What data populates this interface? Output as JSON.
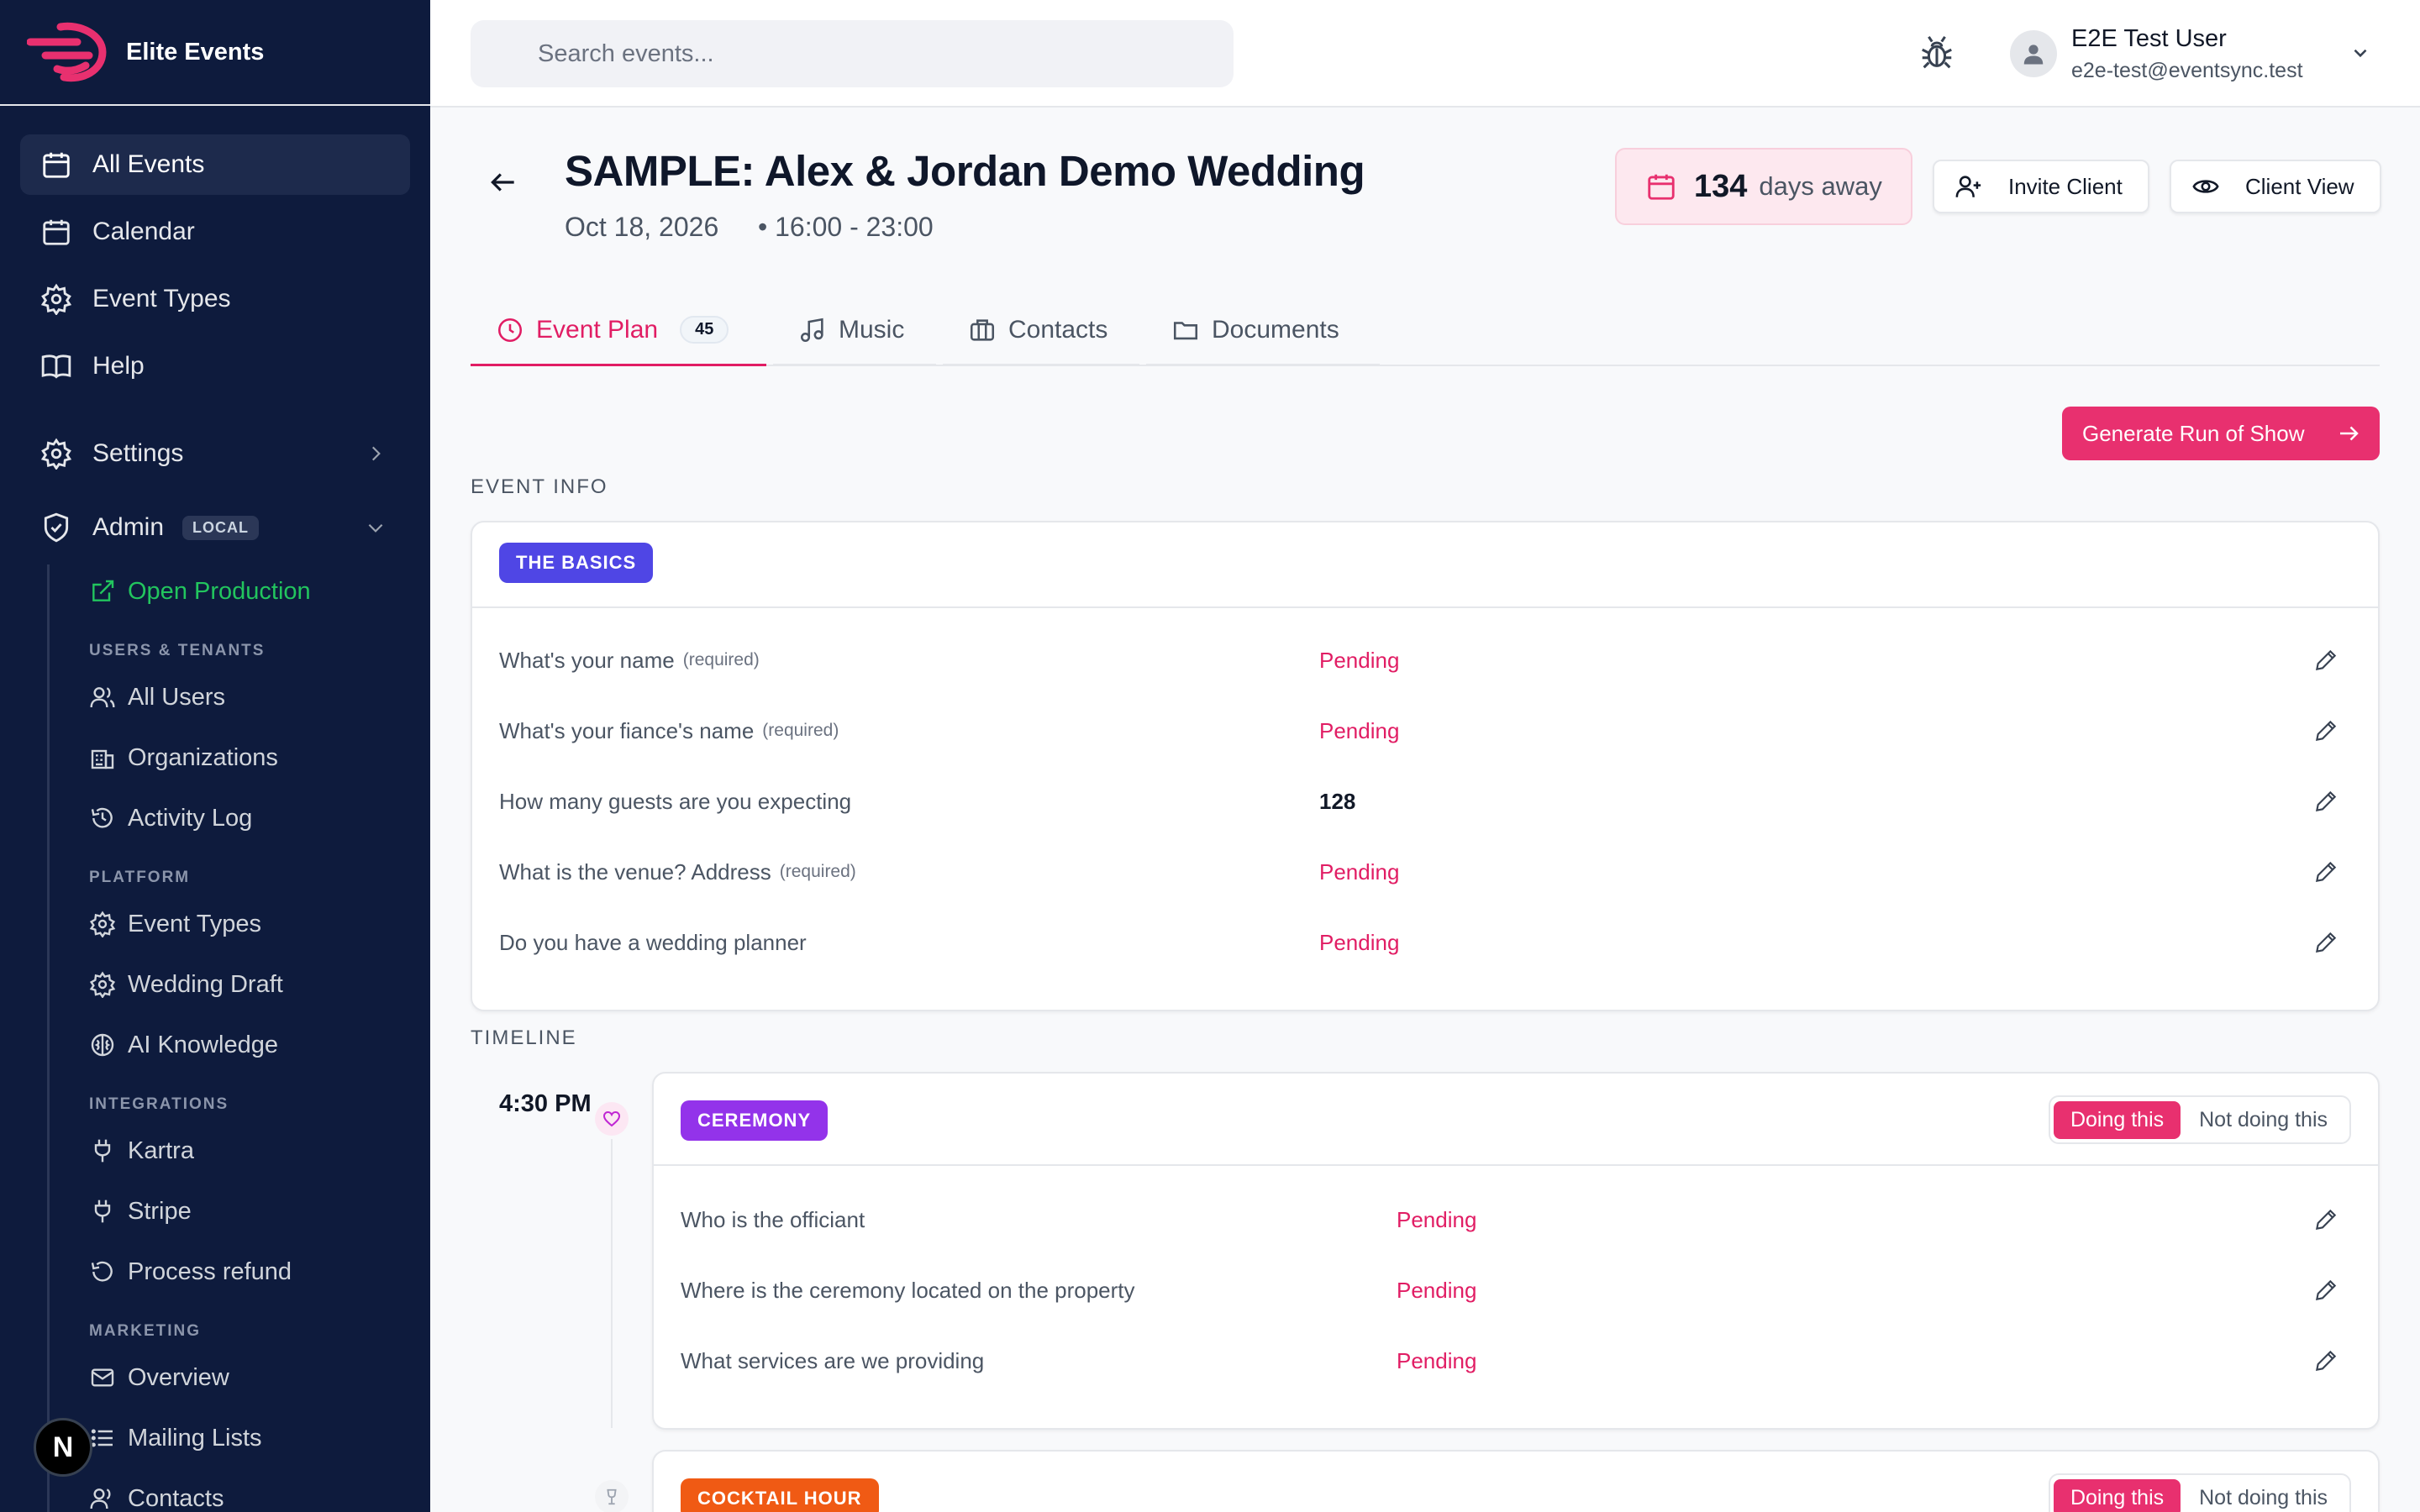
{
  "brand": {
    "name": "Elite Events"
  },
  "sidebar": {
    "main": [
      {
        "label": "All Events",
        "icon": "calendar-icon"
      },
      {
        "label": "Calendar",
        "icon": "calendar-icon"
      },
      {
        "label": "Event Types",
        "icon": "gear-icon"
      },
      {
        "label": "Help",
        "icon": "book-icon"
      }
    ],
    "settings": {
      "label": "Settings"
    },
    "admin": {
      "label": "Admin",
      "badge": "LOCAL"
    },
    "open_production": "Open Production",
    "groups": [
      {
        "header": "USERS & TENANTS",
        "items": [
          "All Users",
          "Organizations",
          "Activity Log"
        ]
      },
      {
        "header": "PLATFORM",
        "items": [
          "Event Types",
          "Wedding Draft",
          "AI Knowledge"
        ]
      },
      {
        "header": "INTEGRATIONS",
        "items": [
          "Kartra",
          "Stripe",
          "Process refund"
        ]
      },
      {
        "header": "MARKETING",
        "items": [
          "Overview",
          "Mailing Lists",
          "Contacts"
        ]
      }
    ],
    "badge_letter": "N"
  },
  "topbar": {
    "search_placeholder": "Search events...",
    "user": {
      "name": "E2E Test User",
      "email": "e2e-test@eventsync.test"
    }
  },
  "event": {
    "title": "SAMPLE: Alex & Jordan Demo Wedding",
    "date": "Oct 18, 2026",
    "time": "• 16:00 - 23:00",
    "days_count": "134",
    "days_label": "days away",
    "invite_label": "Invite Client",
    "client_view_label": "Client View"
  },
  "tabs": [
    {
      "label": "Event Plan",
      "count": "45"
    },
    {
      "label": "Music"
    },
    {
      "label": "Contacts"
    },
    {
      "label": "Documents"
    }
  ],
  "generate_label": "Generate Run of Show",
  "event_info": {
    "section_label": "EVENT INFO",
    "card_title": "THE BASICS",
    "questions": [
      {
        "q": "What's your name",
        "req": "(required)",
        "value": "Pending"
      },
      {
        "q": "What's your fiance's name",
        "req": "(required)",
        "value": "Pending"
      },
      {
        "q": "How many guests are you expecting",
        "req": "",
        "value": "128"
      },
      {
        "q": "What is the venue? Address",
        "req": "(required)",
        "value": "Pending"
      },
      {
        "q": "Do you have a wedding planner",
        "req": "",
        "value": "Pending"
      }
    ]
  },
  "timeline": {
    "section_label": "TIMELINE",
    "blocks": [
      {
        "time": "4:30 PM",
        "title": "CEREMONY",
        "on_label": "Doing this",
        "off_label": "Not doing this",
        "questions": [
          {
            "q": "Who is the officiant",
            "value": "Pending"
          },
          {
            "q": "Where is the ceremony located on the property",
            "value": "Pending"
          },
          {
            "q": "What services are we providing",
            "value": "Pending"
          }
        ]
      },
      {
        "title": "COCKTAIL HOUR",
        "on_label": "Doing this",
        "off_label": "Not doing this"
      }
    ]
  },
  "colors": {
    "sidebar_bg": "#0e1b3d",
    "accent_pink": "#e8306f",
    "basics_pill": "#4f46e5",
    "ceremony_pill": "#9333ea",
    "cocktail_pill": "#f05a14",
    "admin_green": "#22c55e"
  }
}
